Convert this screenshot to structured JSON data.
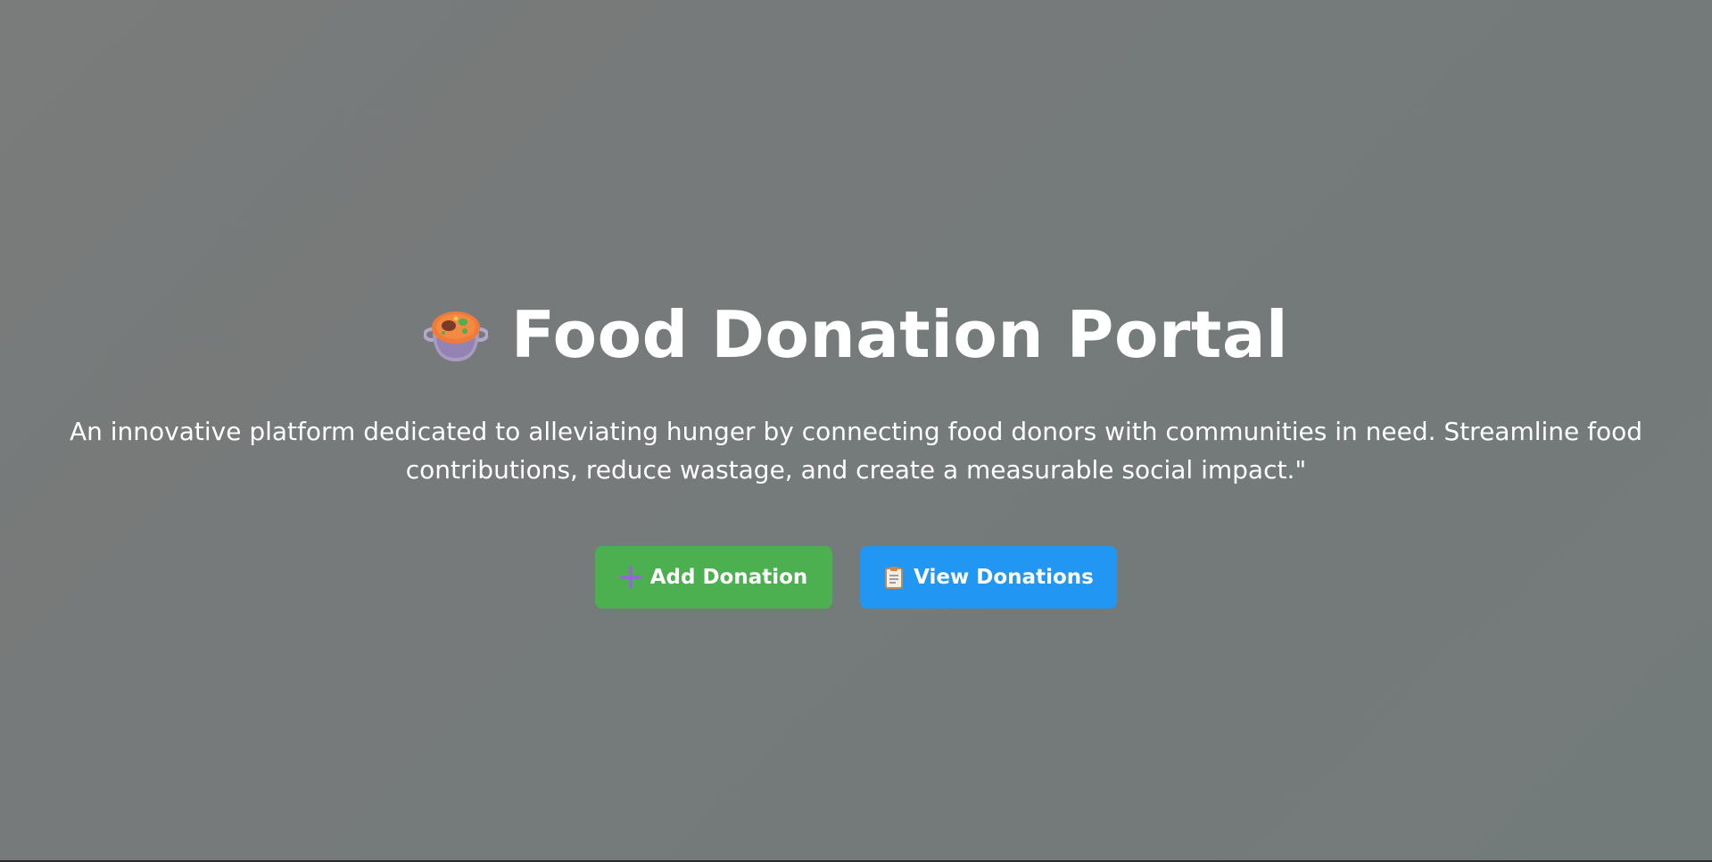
{
  "hero": {
    "title": "Food Donation Portal",
    "title_icon": "stew-pot-icon",
    "description": "An innovative platform dedicated to alleviating hunger by connecting food donors with communities in need. Streamline food contributions, reduce wastage, and create a measurable social impact.\""
  },
  "actions": {
    "add": {
      "label": "Add Donation",
      "icon": "plus-icon",
      "color": "#4caf50"
    },
    "view": {
      "label": "View Donations",
      "icon": "clipboard-icon",
      "color": "#2196f3"
    }
  }
}
